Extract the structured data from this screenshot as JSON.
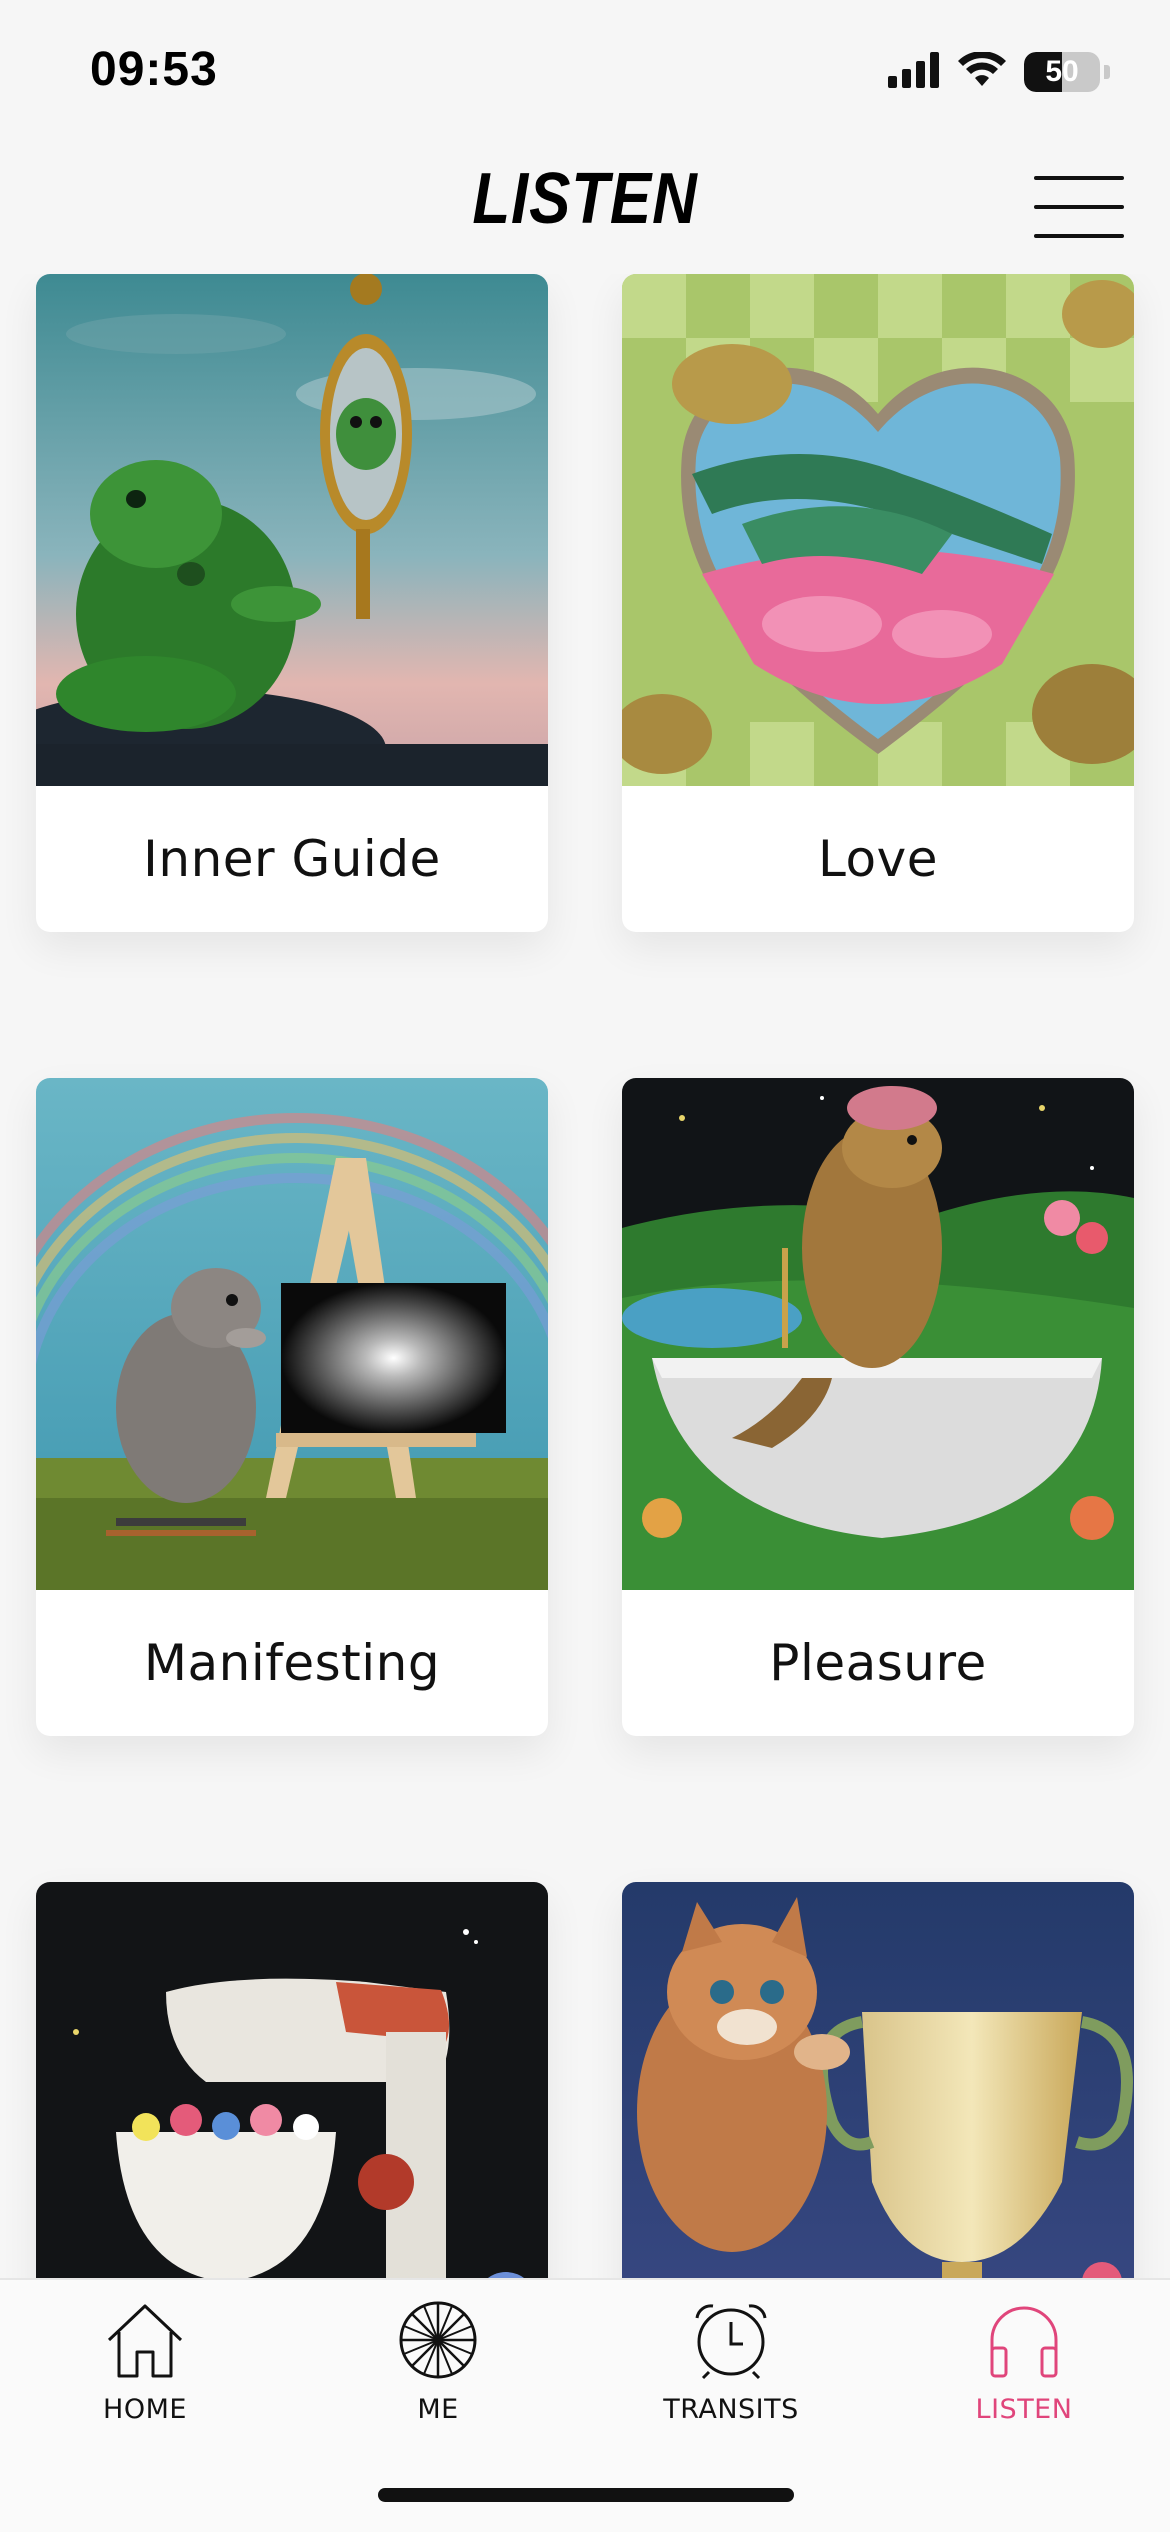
{
  "status_bar": {
    "time": "09:53",
    "battery": "50",
    "battery_level": 0.5
  },
  "header": {
    "title": "LISTEN"
  },
  "cards": [
    {
      "label": "Inner Guide"
    },
    {
      "label": "Love"
    },
    {
      "label": "Manifesting"
    },
    {
      "label": "Pleasure"
    }
  ],
  "nav": {
    "items": [
      {
        "label": "HOME",
        "icon": "home-icon"
      },
      {
        "label": "ME",
        "icon": "wheel-icon"
      },
      {
        "label": "TRANSITS",
        "icon": "alarm-clock-icon"
      },
      {
        "label": "LISTEN",
        "icon": "headphones-icon",
        "active": true
      }
    ]
  },
  "colors": {
    "accent": "#e0457b",
    "background": "#f6f6f6"
  }
}
